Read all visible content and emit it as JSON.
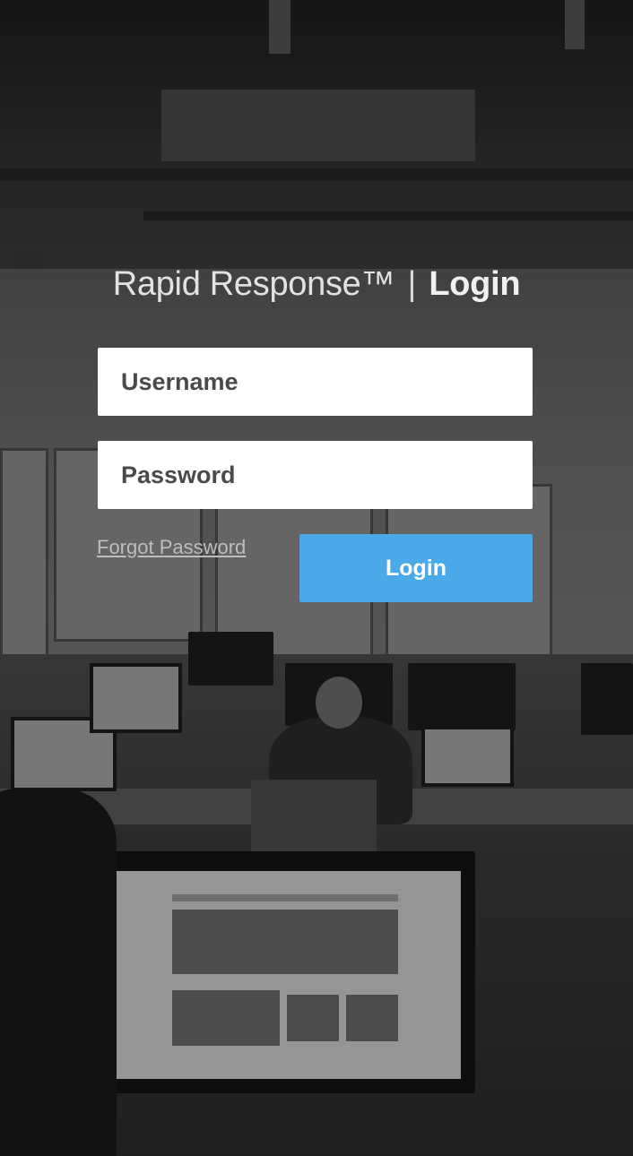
{
  "header": {
    "brand": "Rapid Response™",
    "separator": "|",
    "title": "Login"
  },
  "form": {
    "username_placeholder": "Username",
    "username_value": "",
    "password_placeholder": "Password",
    "password_value": "",
    "forgot_password_label": "Forgot Password",
    "login_button_label": "Login"
  },
  "colors": {
    "accent": "#4aa9e8",
    "field_background": "#ffffff",
    "field_text": "#4a4a4a",
    "title_text": "#e6e6e6"
  }
}
